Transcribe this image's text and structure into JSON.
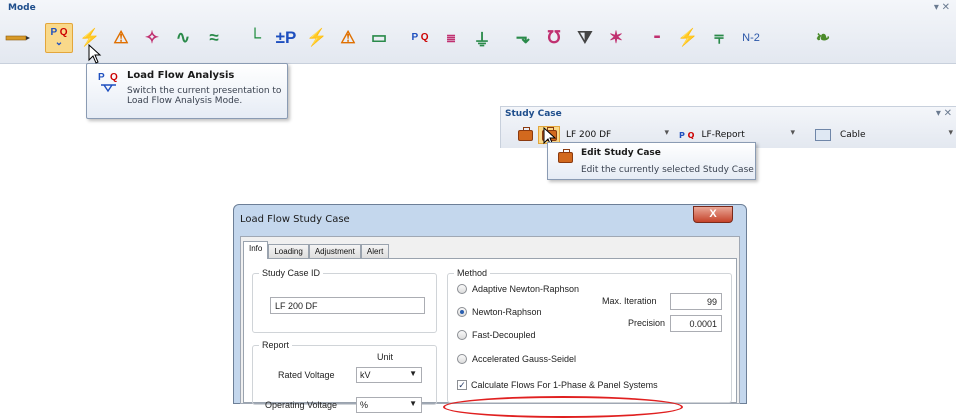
{
  "mode_toolbar": {
    "title": "Mode",
    "pin": "▾ ✕",
    "n2_label": "N-2"
  },
  "load_flow_tooltip": {
    "title": "Load Flow Analysis",
    "description": "Switch the current presentation to Load Flow Analysis Mode."
  },
  "study_case_bar": {
    "title": "Study Case",
    "pin": "▾ ✕",
    "case_value": "LF 200 DF",
    "report_value": "LF-Report",
    "cable_value": "Cable"
  },
  "edit_tooltip": {
    "title": "Edit Study Case",
    "description": "Edit the currently selected Study Case"
  },
  "dialog": {
    "title": "Load Flow Study Case",
    "close": "X",
    "tabs": [
      "Info",
      "Loading",
      "Adjustment",
      "Alert"
    ],
    "study_case_id_label": "Study Case ID",
    "study_case_id_value": "LF 200 DF",
    "report_label": "Report",
    "unit_label": "Unit",
    "rated_voltage_label": "Rated Voltage",
    "rated_voltage_unit": "kV",
    "operating_voltage_label": "Operating Voltage",
    "operating_voltage_unit": "%",
    "method_label": "Method",
    "methods": [
      "Adaptive Newton-Raphson",
      "Newton-Raphson",
      "Fast-Decoupled",
      "Accelerated Gauss-Seidel"
    ],
    "selected_method": "Newton-Raphson",
    "max_iteration_label": "Max. Iteration",
    "max_iteration_value": "99",
    "precision_label": "Precision",
    "precision_value": "0.0001",
    "calc_flows_label": "Calculate Flows For 1-Phase & Panel Systems",
    "calc_flows_checked": true
  },
  "colors": {
    "accent_blue": "#1f4e8c",
    "highlight": "#f9d98a",
    "annotation_red": "#e02020"
  }
}
